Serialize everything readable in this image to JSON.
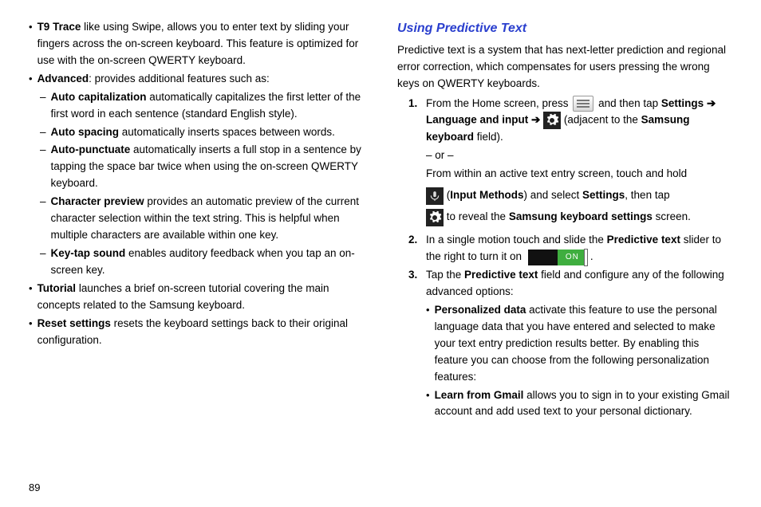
{
  "left": {
    "t9title": "T9 Trace",
    "t9text": " like using Swipe, allows you to enter text by sliding your fingers across the on-screen keyboard. This feature is optimized for use with the on-screen QWERTY keyboard.",
    "advtitle": "Advanced",
    "advtext": ": provides additional features such as:",
    "d1t": "Auto capitalization",
    "d1x": " automatically capitalizes the first letter of the first word in each sentence (standard English style).",
    "d2t": "Auto spacing",
    "d2x": " automatically inserts spaces between words.",
    "d3t": "Auto-punctuate",
    "d3x": " automatically inserts a full stop in a sentence by tapping the space bar twice when using the on-screen QWERTY keyboard.",
    "d4t": "Character preview",
    "d4x": " provides an automatic preview of the current character selection within the text string. This is helpful when multiple characters are available within one key.",
    "d5t": "Key-tap sound",
    "d5x": " enables auditory feedback when you tap an on-screen key.",
    "tuttitle": "Tutorial",
    "tuttext": " launches a brief on-screen tutorial covering the main concepts related to the Samsung keyboard.",
    "rsttitle": "Reset settings",
    "rsttext": " resets the keyboard settings back to their original configuration."
  },
  "right": {
    "heading": "Using Predictive Text",
    "intro": "Predictive text is a system that has next-letter prediction and regional error correction, which compensates for users pressing the wrong keys on QWERTY keyboards.",
    "s1a": "From the Home screen, press ",
    "s1b": " and then tap ",
    "s1_settings": "Settings",
    "s1_langinput": "Language and input",
    "s1c": " (adjacent to the ",
    "s1_sk": "Samsung keyboard",
    "s1d": " field).",
    "or": "– or –",
    "s1e": "From within an active text entry screen, touch and hold ",
    "s1_im": "Input Methods",
    "s1f": ") and select ",
    "s1_set2": "Settings",
    "s1g": ", then tap ",
    "s1h": " to reveal the ",
    "s1_sks": "Samsung keyboard settings",
    "s1i": " screen.",
    "s2a": "In a single motion touch and slide the ",
    "s2_pt": "Predictive text",
    "s2b": " slider to the right to turn it on ",
    "on_label": "ON",
    "s2c": ".",
    "s3a": "Tap the ",
    "s3_pt": "Predictive text",
    "s3b": " field and configure any of the following advanced options:",
    "b1t": "Personalized data",
    "b1x": " activate this feature to use the personal language data that you have entered and selected to make your text entry prediction results better. By enabling this feature you can choose from the following personalization features:",
    "b2t": "Learn from Gmail",
    "b2x": " allows you to sign in to your existing Gmail account and add used text to your personal dictionary."
  },
  "pagenum": "89"
}
